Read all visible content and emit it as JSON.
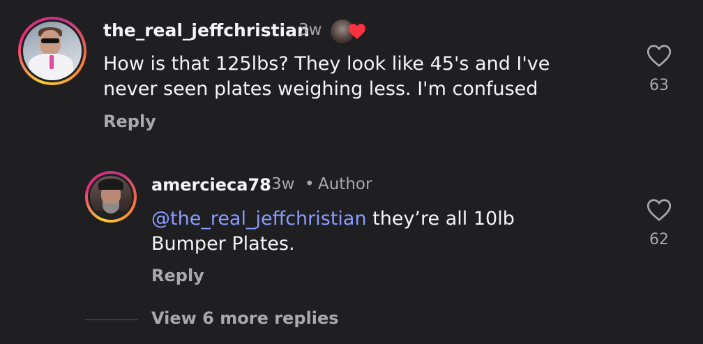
{
  "comment": {
    "username": "the_real_jeffchristian",
    "time": "3w",
    "text": "How is that 125lbs? They look like 45's and I've never seen plates weighing less. I'm confused",
    "reply_label": "Reply",
    "like_count": "63",
    "liked_by_author": true
  },
  "reply": {
    "username": "amercieca78",
    "time": "3w",
    "separator": "•",
    "author_badge": "Author",
    "mention": "@the_real_jeffchristian",
    "text": " they’re all 10lb Bumper Plates.",
    "reply_label": "Reply",
    "like_count": "62"
  },
  "view_more_label": "View 6 more replies",
  "colors": {
    "background": "#1f1f22",
    "mention": "#8a9cff",
    "heart": "#ff3040",
    "muted": "#a8a8ad"
  }
}
